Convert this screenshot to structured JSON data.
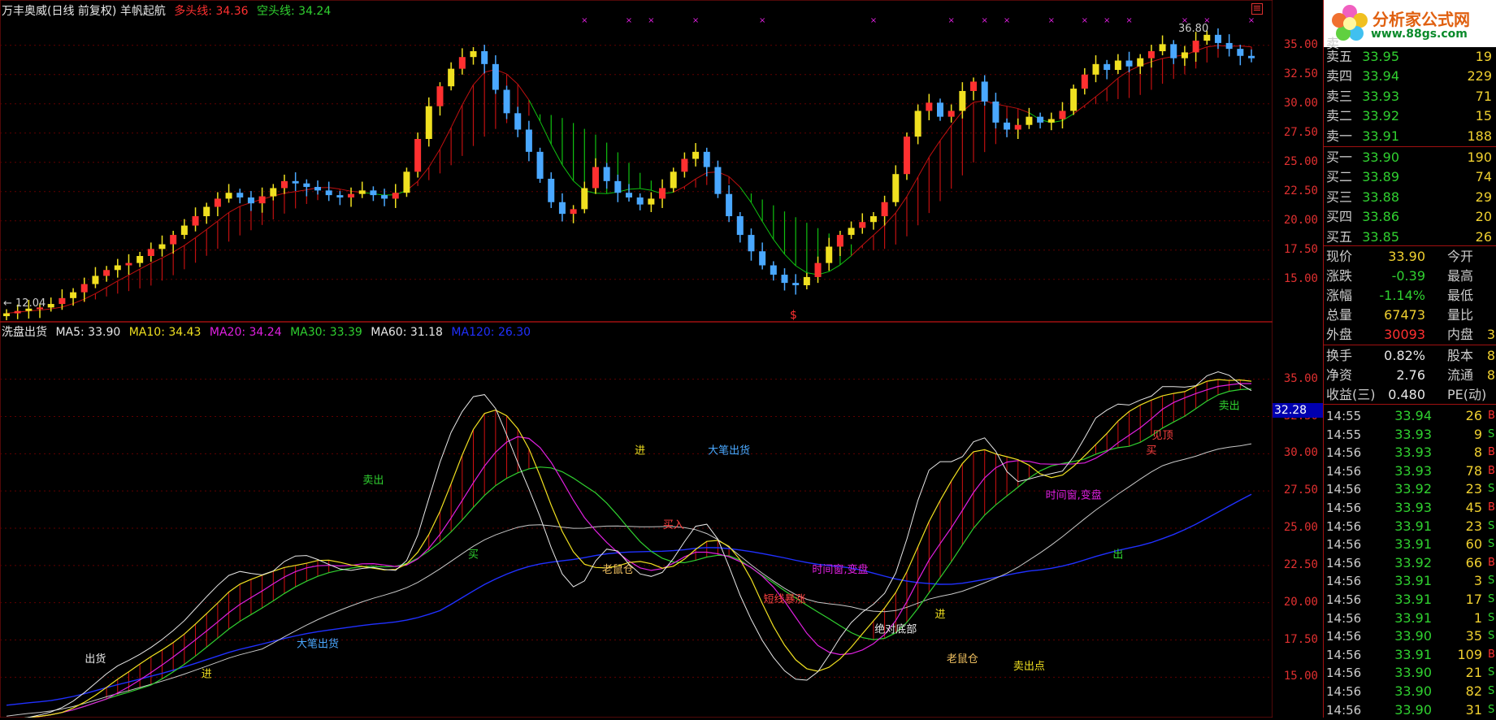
{
  "header": {
    "stock_title": "万丰奥威(日线 前复权) 羊帆起航",
    "long_label": "多头线:",
    "long_value": "34.36",
    "short_label": "空头线:",
    "short_value": "34.24",
    "max_marker": "36.80",
    "min_marker": "← 12.04",
    "dollar_marker": "$"
  },
  "sub_header": {
    "title": "洗盘出货",
    "ma5": "MA5: 33.90",
    "ma10": "MA10: 34.43",
    "ma20": "MA20: 34.24",
    "ma30": "MA30: 33.39",
    "ma60": "MA60: 31.18",
    "ma120": "MA120: 26.30",
    "price_tag": "32.28"
  },
  "top_axis": [
    "35.00",
    "32.50",
    "30.00",
    "27.50",
    "25.00",
    "22.50",
    "20.00",
    "17.50",
    "15.00"
  ],
  "bottom_axis": [
    "35.00",
    "32.50",
    "30.00",
    "27.50",
    "25.00",
    "22.50",
    "20.00",
    "17.50",
    "15.00"
  ],
  "colors": {
    "up": "#ff3030",
    "down": "#4aa8ff",
    "yellow": "#f0e020",
    "green": "#30d030",
    "magenta": "#e020e0",
    "white": "#e8e8e8",
    "blue": "#2030ff",
    "grid": "#600000"
  },
  "chart_data": {
    "type": "candlestick",
    "main_price_range": [
      12,
      37
    ],
    "indicator_range": [
      13,
      37
    ],
    "grid": true,
    "close": [
      12.1,
      12.3,
      12.5,
      12.6,
      12.9,
      13.4,
      13.9,
      14.6,
      15.3,
      15.8,
      16.2,
      16.4,
      17.0,
      17.6,
      18.0,
      18.8,
      19.6,
      20.4,
      21.2,
      21.9,
      22.4,
      22.0,
      21.5,
      22.1,
      22.8,
      23.4,
      23.2,
      22.9,
      22.6,
      22.2,
      22.0,
      22.3,
      22.6,
      22.2,
      21.9,
      22.4,
      24.2,
      27.0,
      29.8,
      31.5,
      33.0,
      34.0,
      34.5,
      33.4,
      31.2,
      29.2,
      27.8,
      25.9,
      23.6,
      21.6,
      20.6,
      21.0,
      22.8,
      24.6,
      23.4,
      22.4,
      22.0,
      21.4,
      21.9,
      22.8,
      24.2,
      25.3,
      25.9,
      24.6,
      22.3,
      20.4,
      18.8,
      17.4,
      16.2,
      15.4,
      14.7,
      14.5,
      15.2,
      16.4,
      17.8,
      18.8,
      19.4,
      19.9,
      20.4,
      21.6,
      24.0,
      27.2,
      29.4,
      30.1,
      28.9,
      29.4,
      31.1,
      31.9,
      30.2,
      28.4,
      27.8,
      28.2,
      28.9,
      28.4,
      28.7,
      29.4,
      31.3,
      32.5,
      33.4,
      32.9,
      33.7,
      33.2,
      33.9,
      34.5,
      35.1,
      33.9,
      34.4,
      35.4,
      35.9,
      35.2,
      34.7,
      34.1,
      33.9
    ],
    "annotations_top": [
      "$"
    ],
    "annotations_bottom": [
      "大笔出货",
      "出货",
      "卖出",
      "买",
      "进",
      "买入",
      "短线暴涨",
      "时间窗,变盘",
      "绝对底部",
      "老鼠仓",
      "卖出点",
      "出",
      "见顶",
      "卖出"
    ]
  },
  "quote": {
    "sell_title": "卖",
    "sell": [
      {
        "label": "卖五",
        "price": "33.95",
        "vol": "19"
      },
      {
        "label": "卖四",
        "price": "33.94",
        "vol": "229"
      },
      {
        "label": "卖三",
        "price": "33.93",
        "vol": "71"
      },
      {
        "label": "卖二",
        "price": "33.92",
        "vol": "15"
      },
      {
        "label": "卖一",
        "price": "33.91",
        "vol": "188"
      }
    ],
    "buy": [
      {
        "label": "买一",
        "price": "33.90",
        "vol": "190"
      },
      {
        "label": "买二",
        "price": "33.89",
        "vol": "74"
      },
      {
        "label": "买三",
        "price": "33.88",
        "vol": "29"
      },
      {
        "label": "买四",
        "price": "33.86",
        "vol": "20"
      },
      {
        "label": "买五",
        "price": "33.85",
        "vol": "26"
      }
    ],
    "stats": [
      {
        "l1": "现价",
        "v1": "33.90",
        "l2": "今开",
        "c": "#f0d030"
      },
      {
        "l1": "涨跌",
        "v1": "-0.39",
        "l2": "最高",
        "c": "#30d030"
      },
      {
        "l1": "涨幅",
        "v1": "-1.14%",
        "l2": "最低",
        "c": "#30d030"
      },
      {
        "l1": "总量",
        "v1": "67473",
        "l2": "量比",
        "c": "#f0d030"
      },
      {
        "l1": "外盘",
        "v1": "30093",
        "l2": "内盘",
        "c": "#ff3030",
        "extra": "3"
      },
      {
        "l1": "换手",
        "v1": "0.82%",
        "l2": "股本",
        "c": "#e8e8e8",
        "extra": "8"
      },
      {
        "l1": "净资",
        "v1": "2.76",
        "l2": "流通",
        "c": "#e8e8e8",
        "extra": "8"
      },
      {
        "l1": "收益(三)",
        "v1": "0.480",
        "l2": "PE(动)",
        "c": "#e8e8e8"
      }
    ],
    "ticks": [
      {
        "t": "14:55",
        "p": "33.94",
        "v": "26",
        "s": "B"
      },
      {
        "t": "14:55",
        "p": "33.93",
        "v": "9",
        "s": "S"
      },
      {
        "t": "14:56",
        "p": "33.93",
        "v": "8",
        "s": "B"
      },
      {
        "t": "14:56",
        "p": "33.93",
        "v": "78",
        "s": "B"
      },
      {
        "t": "14:56",
        "p": "33.92",
        "v": "23",
        "s": "S"
      },
      {
        "t": "14:56",
        "p": "33.93",
        "v": "45",
        "s": "B"
      },
      {
        "t": "14:56",
        "p": "33.91",
        "v": "23",
        "s": "S"
      },
      {
        "t": "14:56",
        "p": "33.91",
        "v": "60",
        "s": "S"
      },
      {
        "t": "14:56",
        "p": "33.92",
        "v": "66",
        "s": "B"
      },
      {
        "t": "14:56",
        "p": "33.91",
        "v": "3",
        "s": "S"
      },
      {
        "t": "14:56",
        "p": "33.91",
        "v": "17",
        "s": "S"
      },
      {
        "t": "14:56",
        "p": "33.91",
        "v": "1",
        "s": "S"
      },
      {
        "t": "14:56",
        "p": "33.90",
        "v": "35",
        "s": "S"
      },
      {
        "t": "14:56",
        "p": "33.91",
        "v": "109",
        "s": "B"
      },
      {
        "t": "14:56",
        "p": "33.90",
        "v": "21",
        "s": "S"
      },
      {
        "t": "14:56",
        "p": "33.90",
        "v": "82",
        "s": "S"
      },
      {
        "t": "14:56",
        "p": "33.90",
        "v": "31",
        "s": "S"
      }
    ]
  },
  "logo": {
    "title": "分析家公式网",
    "url": "www.88gs.com"
  }
}
